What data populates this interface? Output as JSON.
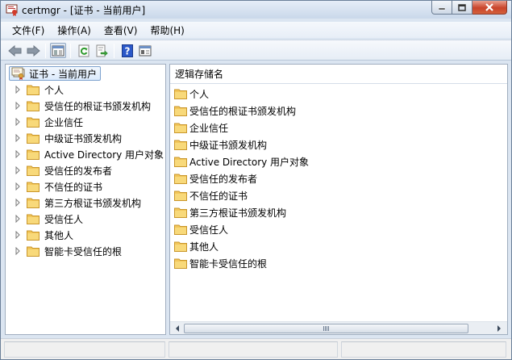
{
  "window": {
    "title": "certmgr - [证书 - 当前用户]"
  },
  "menu": [
    {
      "label": "文件(F)"
    },
    {
      "label": "操作(A)"
    },
    {
      "label": "查看(V)"
    },
    {
      "label": "帮助(H)"
    }
  ],
  "toolbar": {
    "icons": [
      "back-arrow-icon",
      "forward-arrow-icon",
      "show-hide-tree-icon",
      "refresh-icon",
      "export-list-icon",
      "help-icon",
      "properties-icon"
    ]
  },
  "tree": {
    "root_label": "证书 - 当前用户",
    "items": [
      {
        "label": "个人"
      },
      {
        "label": "受信任的根证书颁发机构"
      },
      {
        "label": "企业信任"
      },
      {
        "label": "中级证书颁发机构"
      },
      {
        "label": "Active Directory 用户对象"
      },
      {
        "label": "受信任的发布者"
      },
      {
        "label": "不信任的证书"
      },
      {
        "label": "第三方根证书颁发机构"
      },
      {
        "label": "受信任人"
      },
      {
        "label": "其他人"
      },
      {
        "label": "智能卡受信任的根"
      }
    ]
  },
  "list": {
    "column_header": "逻辑存储名",
    "items": [
      {
        "label": "个人"
      },
      {
        "label": "受信任的根证书颁发机构"
      },
      {
        "label": "企业信任"
      },
      {
        "label": "中级证书颁发机构"
      },
      {
        "label": "Active Directory 用户对象"
      },
      {
        "label": "受信任的发布者"
      },
      {
        "label": "不信任的证书"
      },
      {
        "label": "第三方根证书颁发机构"
      },
      {
        "label": "受信任人"
      },
      {
        "label": "其他人"
      },
      {
        "label": "智能卡受信任的根"
      }
    ]
  },
  "colors": {
    "folder": "#f2c65a",
    "folder_dark": "#c9962b",
    "selection_border": "#7da2ce"
  }
}
